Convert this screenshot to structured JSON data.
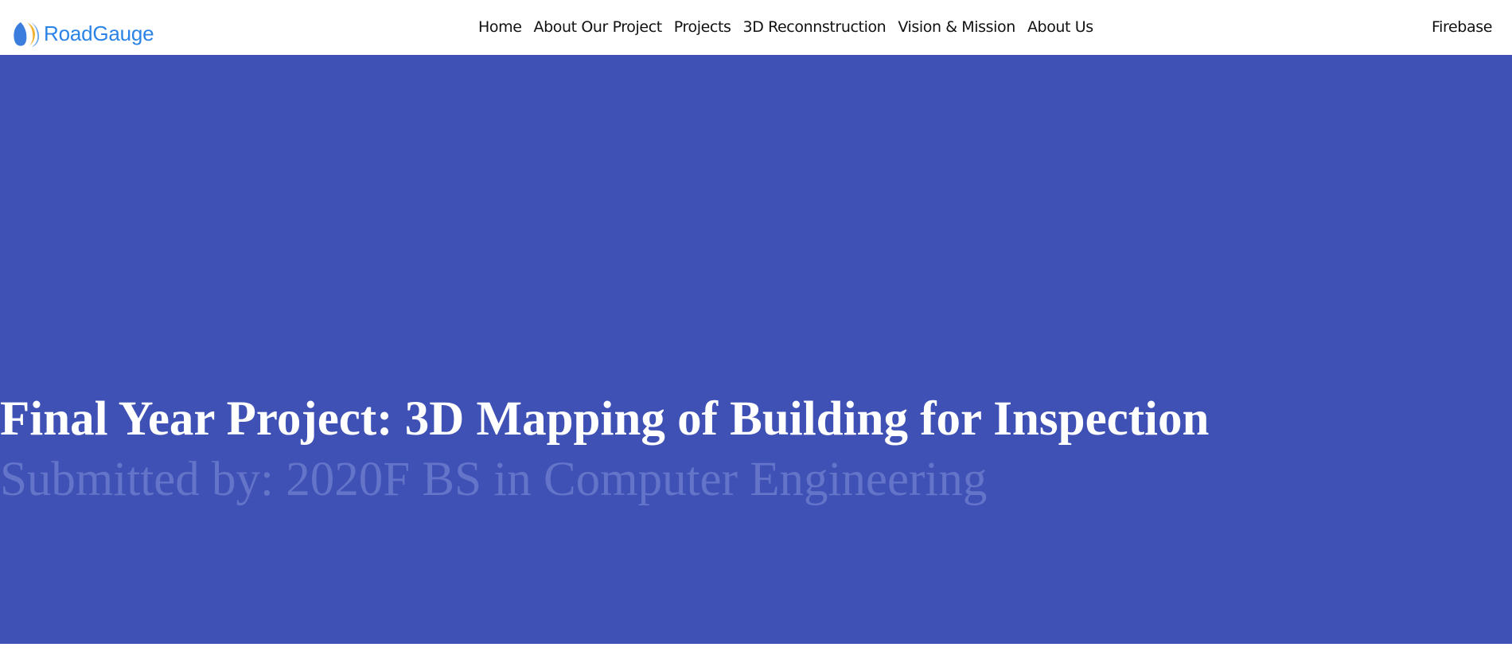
{
  "brand": {
    "name": "RoadGauge",
    "logo_icon": "roadgauge-logo-icon",
    "logo_colors": [
      "#3b7ddd",
      "#f2b233",
      "#6aa6f0"
    ]
  },
  "nav": {
    "links": [
      {
        "label": "Home"
      },
      {
        "label": "About Our Project"
      },
      {
        "label": "Projects"
      },
      {
        "label": "3D Reconnstruction"
      },
      {
        "label": "Vision & Mission"
      },
      {
        "label": "About Us"
      }
    ],
    "right_link": "Firebase"
  },
  "hero": {
    "title": "Final Year Project: 3D Mapping of Building for Inspection",
    "subtitle": "Submitted by: 2020F BS in Computer Engineering",
    "background_color": "#3f51b5",
    "title_color": "#ffffff",
    "subtitle_color": "#6374c9"
  }
}
